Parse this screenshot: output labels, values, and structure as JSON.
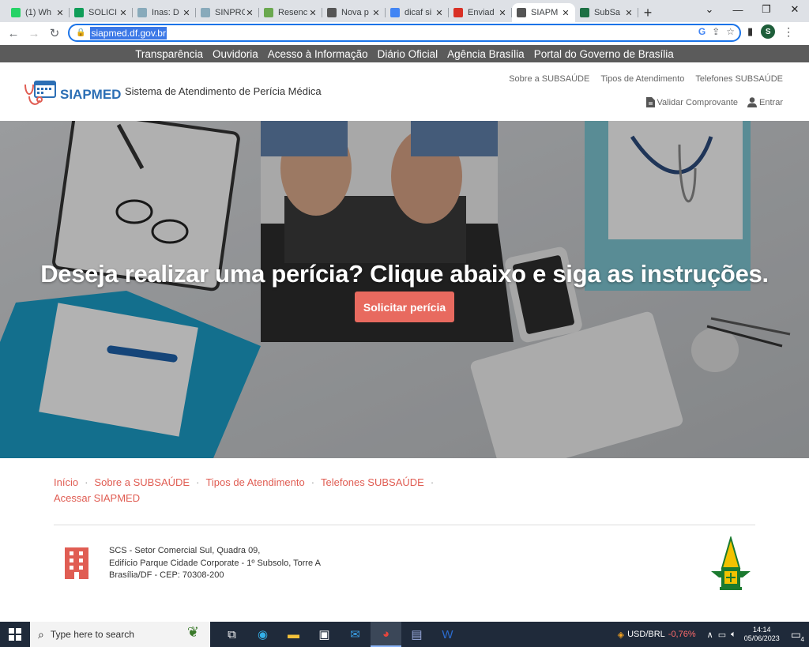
{
  "browser": {
    "tabs": [
      {
        "label": "(1) Wh",
        "icon": "whatsapp-icon",
        "color": "#25d366"
      },
      {
        "label": "SOLICI",
        "icon": "sheets-icon",
        "color": "#0f9d58"
      },
      {
        "label": "Inas: D",
        "icon": "globe-icon",
        "color": "#8ab"
      },
      {
        "label": "SINPRO",
        "icon": "globe-icon",
        "color": "#8ab"
      },
      {
        "label": "Resenc",
        "icon": "page-icon",
        "color": "#6aa84f"
      },
      {
        "label": "Nova p",
        "icon": "chrome-icon",
        "color": "#555"
      },
      {
        "label": "dicaf si",
        "icon": "google-icon",
        "color": "#4285f4"
      },
      {
        "label": "Enviad",
        "icon": "gmail-icon",
        "color": "#d93025"
      },
      {
        "label": "SIAPM",
        "icon": "globe-icon",
        "color": "#555",
        "active": true
      },
      {
        "label": "SubSa",
        "icon": "excel-icon",
        "color": "#1d7044"
      }
    ],
    "url": "siapmed.df.gov.br",
    "profile_initial": "S"
  },
  "govbar": {
    "links": [
      "Transparência",
      "Ouvidoria",
      "Acesso à Informação",
      "Diário Oficial",
      "Agência Brasília",
      "Portal do Governo de Brasília"
    ]
  },
  "header": {
    "logo_text": "SIAPMED",
    "tagline": "Sistema de Atendimento de Perícia Médica",
    "topnav": [
      "Sobre a SUBSAÚDE",
      "Tipos de Atendimento",
      "Telefones SUBSAÚDE"
    ],
    "validate_label": "Validar Comprovante",
    "login_label": "Entrar"
  },
  "hero": {
    "title": "Deseja realizar uma perícia? Clique abaixo e siga as instruções.",
    "button_label": "Solicitar perícia"
  },
  "footer": {
    "links": [
      "Início",
      "Sobre a SUBSAÚDE",
      "Tipos de Atendimento",
      "Telefones SUBSAÚDE",
      "Acessar SIAPMED"
    ],
    "address": [
      "SCS - Setor Comercial Sul, Quadra 09,",
      "Edifício Parque Cidade Corporate - 1º Subsolo, Torre A",
      "Brasília/DF - CEP: 70308-200"
    ]
  },
  "taskbar": {
    "search_placeholder": "Type here to search",
    "currency_label": "USD/BRL",
    "currency_change": "-0,76%",
    "time": "14:14",
    "date": "05/06/2023",
    "notification_count": "4"
  }
}
